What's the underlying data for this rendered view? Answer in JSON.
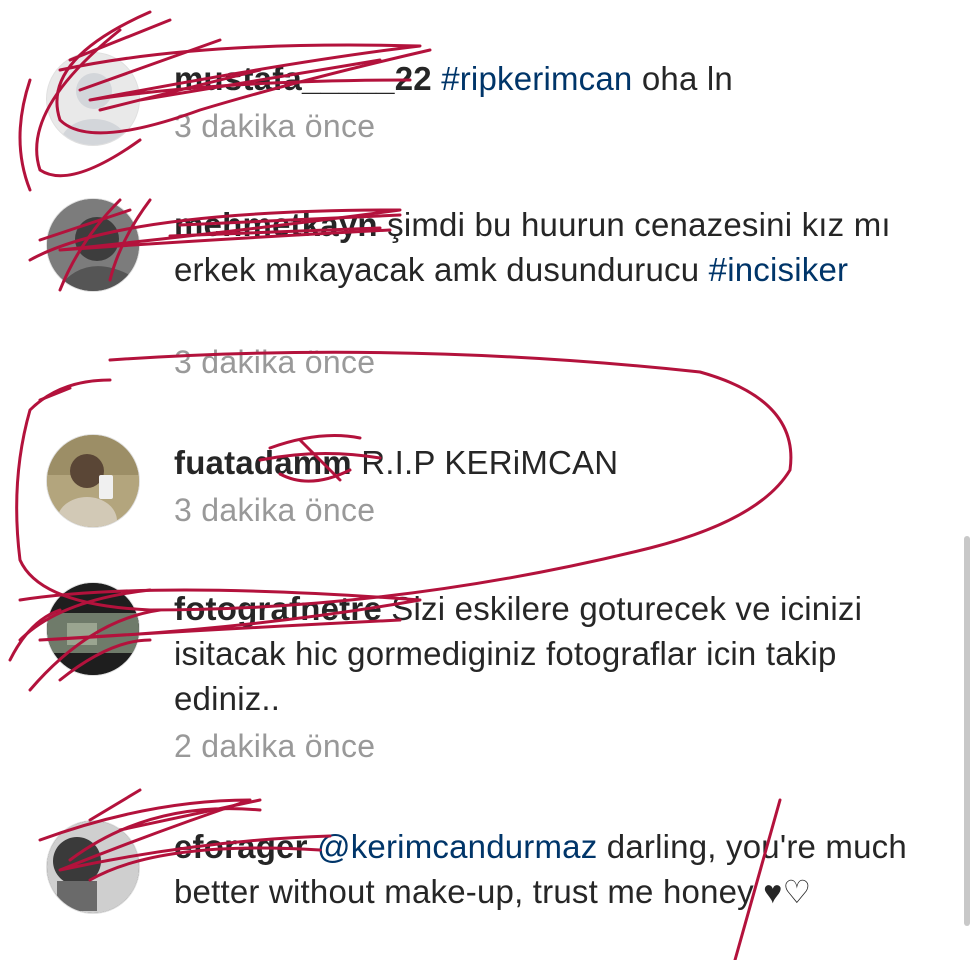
{
  "comments": [
    {
      "username": "mustafa_____22",
      "text_parts": [
        "#ripkerimcan",
        " oha ln"
      ],
      "time": "3 dakika önce"
    },
    {
      "username": "mehmetkayn",
      "text_parts": [
        " şimdi bu huurun cenazesini kız mı erkek mıkayacak amk dusundurucu ",
        "#incisiker"
      ],
      "time": "3 dakika önce"
    },
    {
      "username": "fuatadamm",
      "text_parts": [
        " R.I.P KERiMCAN"
      ],
      "time": "3 dakika önce"
    },
    {
      "username": "fotografnetre",
      "text_parts": [
        " Sizi eskilere goturecek ve icinizi isitacak hic gormediginiz fotograflar icin takip ediniz.."
      ],
      "time": "2 dakika önce"
    },
    {
      "username": "eforager",
      "text_parts": [
        " @kerimcandurmaz",
        " darling, you're much better without make-up, trust me honey"
      ],
      "hearts": "♥♡"
    }
  ],
  "colors": {
    "hashtag": "#003569",
    "timestamp": "#999999",
    "scribble": "#b3123c"
  },
  "icons": [
    "avatar-image",
    "scribble-overlay"
  ]
}
